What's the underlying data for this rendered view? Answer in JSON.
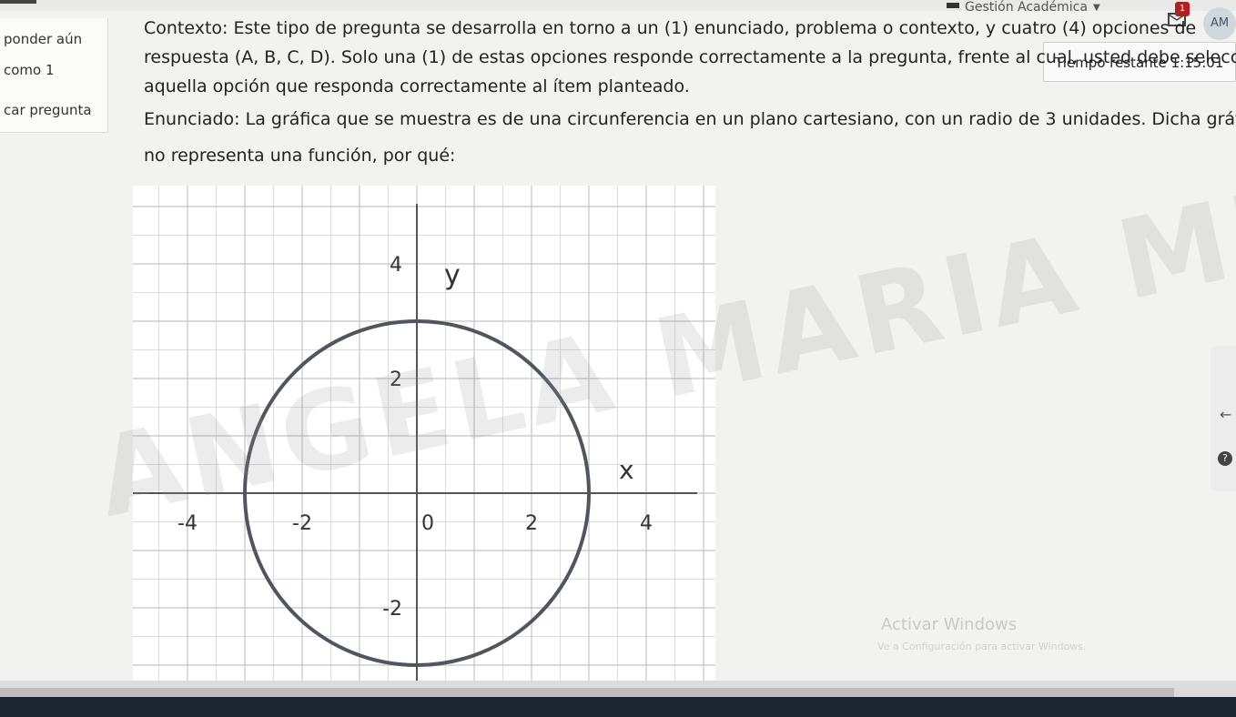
{
  "header": {
    "brand": "Gestión Académica",
    "notification_count": "1",
    "avatar_initials": "AM"
  },
  "sidebar": {
    "items": [
      "ponder aún",
      "como 1",
      "car pregunta"
    ]
  },
  "timer": {
    "label": "Tiempo restante",
    "value": "1:15:01"
  },
  "question": {
    "context_line1": "Contexto: Este tipo de pregunta se desarrolla en torno a un (1) enunciado, problema o contexto, y cuatro (4) opciones de",
    "context_line2": "respuesta (A, B, C, D). Solo una (1) de estas opciones responde correctamente a la pregunta, frente al cual, usted debe seleccionar",
    "context_line3": "aquella opción que responda correctamente al ítem planteado.",
    "statement_line1": "Enunciado: La gráfica que se muestra es de una circunferencia en un plano cartesiano, con un radio de 3 unidades. Dicha gráfica",
    "statement_line2": "no representa una función, por qué:"
  },
  "graph": {
    "x_label": "x",
    "y_label": "y",
    "x_ticks": [
      "-4",
      "-2",
      "0",
      "2",
      "4"
    ],
    "y_ticks": [
      "4",
      "2",
      "-2"
    ],
    "circle_radius": 3
  },
  "watermark": "ANGELA MARIA MUELAS",
  "windows_activation": {
    "title": "Activar Windows",
    "subtitle": "Ve a Configuración para activar Windows."
  },
  "widgets": {
    "help": "?"
  }
}
